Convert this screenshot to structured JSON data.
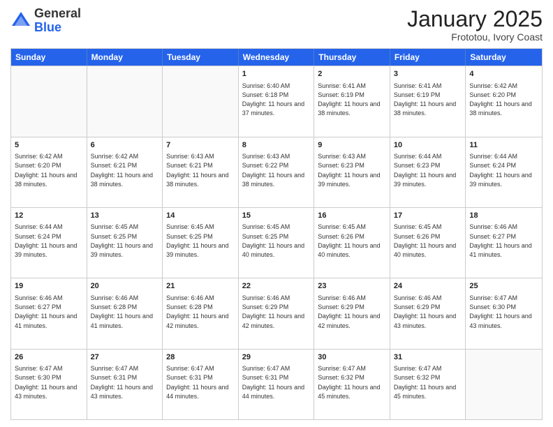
{
  "header": {
    "logo_line1": "General",
    "logo_line2": "Blue",
    "month_title": "January 2025",
    "location": "Frototou, Ivory Coast"
  },
  "days_of_week": [
    "Sunday",
    "Monday",
    "Tuesday",
    "Wednesday",
    "Thursday",
    "Friday",
    "Saturday"
  ],
  "weeks": [
    [
      {
        "day": "",
        "sunrise": "",
        "sunset": "",
        "daylight": ""
      },
      {
        "day": "",
        "sunrise": "",
        "sunset": "",
        "daylight": ""
      },
      {
        "day": "",
        "sunrise": "",
        "sunset": "",
        "daylight": ""
      },
      {
        "day": "1",
        "sunrise": "Sunrise: 6:40 AM",
        "sunset": "Sunset: 6:18 PM",
        "daylight": "Daylight: 11 hours and 37 minutes."
      },
      {
        "day": "2",
        "sunrise": "Sunrise: 6:41 AM",
        "sunset": "Sunset: 6:19 PM",
        "daylight": "Daylight: 11 hours and 38 minutes."
      },
      {
        "day": "3",
        "sunrise": "Sunrise: 6:41 AM",
        "sunset": "Sunset: 6:19 PM",
        "daylight": "Daylight: 11 hours and 38 minutes."
      },
      {
        "day": "4",
        "sunrise": "Sunrise: 6:42 AM",
        "sunset": "Sunset: 6:20 PM",
        "daylight": "Daylight: 11 hours and 38 minutes."
      }
    ],
    [
      {
        "day": "5",
        "sunrise": "Sunrise: 6:42 AM",
        "sunset": "Sunset: 6:20 PM",
        "daylight": "Daylight: 11 hours and 38 minutes."
      },
      {
        "day": "6",
        "sunrise": "Sunrise: 6:42 AM",
        "sunset": "Sunset: 6:21 PM",
        "daylight": "Daylight: 11 hours and 38 minutes."
      },
      {
        "day": "7",
        "sunrise": "Sunrise: 6:43 AM",
        "sunset": "Sunset: 6:21 PM",
        "daylight": "Daylight: 11 hours and 38 minutes."
      },
      {
        "day": "8",
        "sunrise": "Sunrise: 6:43 AM",
        "sunset": "Sunset: 6:22 PM",
        "daylight": "Daylight: 11 hours and 38 minutes."
      },
      {
        "day": "9",
        "sunrise": "Sunrise: 6:43 AM",
        "sunset": "Sunset: 6:23 PM",
        "daylight": "Daylight: 11 hours and 39 minutes."
      },
      {
        "day": "10",
        "sunrise": "Sunrise: 6:44 AM",
        "sunset": "Sunset: 6:23 PM",
        "daylight": "Daylight: 11 hours and 39 minutes."
      },
      {
        "day": "11",
        "sunrise": "Sunrise: 6:44 AM",
        "sunset": "Sunset: 6:24 PM",
        "daylight": "Daylight: 11 hours and 39 minutes."
      }
    ],
    [
      {
        "day": "12",
        "sunrise": "Sunrise: 6:44 AM",
        "sunset": "Sunset: 6:24 PM",
        "daylight": "Daylight: 11 hours and 39 minutes."
      },
      {
        "day": "13",
        "sunrise": "Sunrise: 6:45 AM",
        "sunset": "Sunset: 6:25 PM",
        "daylight": "Daylight: 11 hours and 39 minutes."
      },
      {
        "day": "14",
        "sunrise": "Sunrise: 6:45 AM",
        "sunset": "Sunset: 6:25 PM",
        "daylight": "Daylight: 11 hours and 39 minutes."
      },
      {
        "day": "15",
        "sunrise": "Sunrise: 6:45 AM",
        "sunset": "Sunset: 6:25 PM",
        "daylight": "Daylight: 11 hours and 40 minutes."
      },
      {
        "day": "16",
        "sunrise": "Sunrise: 6:45 AM",
        "sunset": "Sunset: 6:26 PM",
        "daylight": "Daylight: 11 hours and 40 minutes."
      },
      {
        "day": "17",
        "sunrise": "Sunrise: 6:45 AM",
        "sunset": "Sunset: 6:26 PM",
        "daylight": "Daylight: 11 hours and 40 minutes."
      },
      {
        "day": "18",
        "sunrise": "Sunrise: 6:46 AM",
        "sunset": "Sunset: 6:27 PM",
        "daylight": "Daylight: 11 hours and 41 minutes."
      }
    ],
    [
      {
        "day": "19",
        "sunrise": "Sunrise: 6:46 AM",
        "sunset": "Sunset: 6:27 PM",
        "daylight": "Daylight: 11 hours and 41 minutes."
      },
      {
        "day": "20",
        "sunrise": "Sunrise: 6:46 AM",
        "sunset": "Sunset: 6:28 PM",
        "daylight": "Daylight: 11 hours and 41 minutes."
      },
      {
        "day": "21",
        "sunrise": "Sunrise: 6:46 AM",
        "sunset": "Sunset: 6:28 PM",
        "daylight": "Daylight: 11 hours and 42 minutes."
      },
      {
        "day": "22",
        "sunrise": "Sunrise: 6:46 AM",
        "sunset": "Sunset: 6:29 PM",
        "daylight": "Daylight: 11 hours and 42 minutes."
      },
      {
        "day": "23",
        "sunrise": "Sunrise: 6:46 AM",
        "sunset": "Sunset: 6:29 PM",
        "daylight": "Daylight: 11 hours and 42 minutes."
      },
      {
        "day": "24",
        "sunrise": "Sunrise: 6:46 AM",
        "sunset": "Sunset: 6:29 PM",
        "daylight": "Daylight: 11 hours and 43 minutes."
      },
      {
        "day": "25",
        "sunrise": "Sunrise: 6:47 AM",
        "sunset": "Sunset: 6:30 PM",
        "daylight": "Daylight: 11 hours and 43 minutes."
      }
    ],
    [
      {
        "day": "26",
        "sunrise": "Sunrise: 6:47 AM",
        "sunset": "Sunset: 6:30 PM",
        "daylight": "Daylight: 11 hours and 43 minutes."
      },
      {
        "day": "27",
        "sunrise": "Sunrise: 6:47 AM",
        "sunset": "Sunset: 6:31 PM",
        "daylight": "Daylight: 11 hours and 43 minutes."
      },
      {
        "day": "28",
        "sunrise": "Sunrise: 6:47 AM",
        "sunset": "Sunset: 6:31 PM",
        "daylight": "Daylight: 11 hours and 44 minutes."
      },
      {
        "day": "29",
        "sunrise": "Sunrise: 6:47 AM",
        "sunset": "Sunset: 6:31 PM",
        "daylight": "Daylight: 11 hours and 44 minutes."
      },
      {
        "day": "30",
        "sunrise": "Sunrise: 6:47 AM",
        "sunset": "Sunset: 6:32 PM",
        "daylight": "Daylight: 11 hours and 45 minutes."
      },
      {
        "day": "31",
        "sunrise": "Sunrise: 6:47 AM",
        "sunset": "Sunset: 6:32 PM",
        "daylight": "Daylight: 11 hours and 45 minutes."
      },
      {
        "day": "",
        "sunrise": "",
        "sunset": "",
        "daylight": ""
      }
    ]
  ]
}
